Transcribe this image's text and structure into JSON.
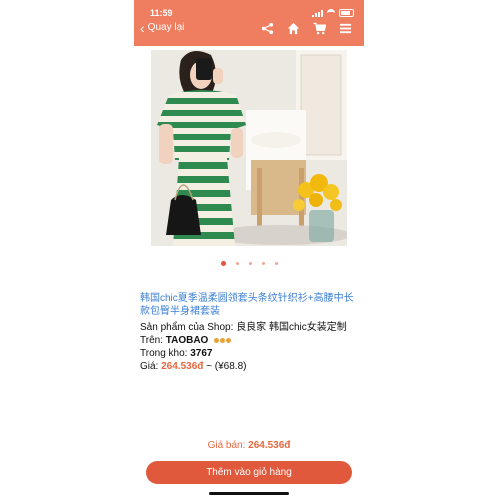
{
  "status_bar": {
    "time": "11:59"
  },
  "header": {
    "back_label": "Quay lại",
    "icons": [
      "share-icon",
      "home-icon",
      "cart-icon",
      "menu-icon"
    ],
    "accent_color": "#ef7d60"
  },
  "gallery": {
    "image_count": 5,
    "active_index": 0
  },
  "product": {
    "title": "韩国chic夏季温柔圆领套头条纹针织衫+高腰中长款包臀半身裙套装",
    "shop_label": "Sản phẩm của Shop:",
    "shop_name": "良良家 韩国chic女装定制",
    "source_label": "Trên:",
    "source_name": "TAOBAO",
    "stock_label": "Trong kho:",
    "stock_value": "3767",
    "price_label": "Giá:",
    "price_value": "264.536đ",
    "price_cny": "~ (¥68.8)"
  },
  "footer": {
    "sale_label": "Giá bán:",
    "sale_value": "264.536đ",
    "cart_button": "Thêm vào giỏ hàng",
    "button_color": "#e1593d"
  }
}
